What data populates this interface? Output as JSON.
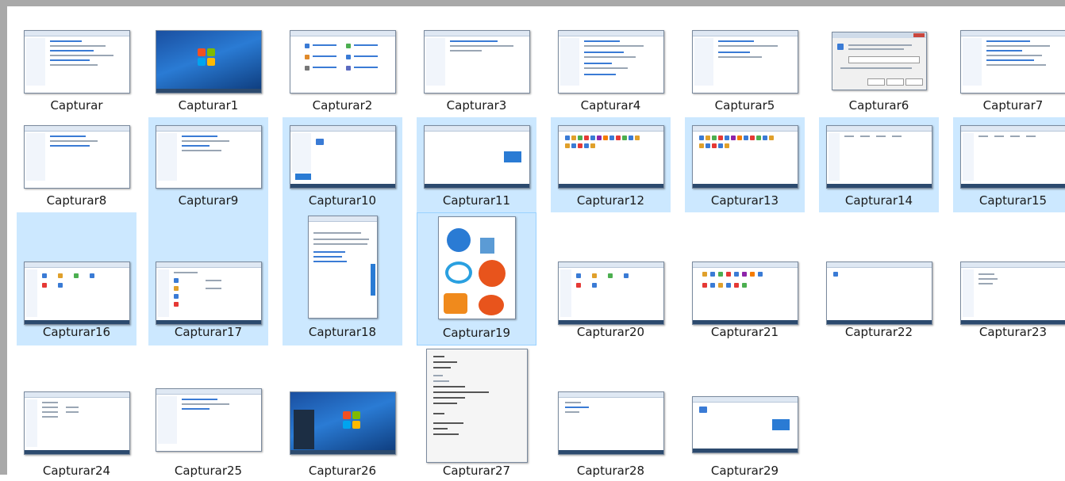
{
  "files": [
    {
      "name": "Capturar",
      "selected": false
    },
    {
      "name": "Capturar1",
      "selected": false
    },
    {
      "name": "Capturar2",
      "selected": false
    },
    {
      "name": "Capturar3",
      "selected": false
    },
    {
      "name": "Capturar4",
      "selected": false
    },
    {
      "name": "Capturar5",
      "selected": false
    },
    {
      "name": "Capturar6",
      "selected": false
    },
    {
      "name": "Capturar7",
      "selected": false
    },
    {
      "name": "Capturar8",
      "selected": false
    },
    {
      "name": "Capturar9",
      "selected": true
    },
    {
      "name": "Capturar10",
      "selected": true
    },
    {
      "name": "Capturar11",
      "selected": true
    },
    {
      "name": "Capturar12",
      "selected": true
    },
    {
      "name": "Capturar13",
      "selected": true
    },
    {
      "name": "Capturar14",
      "selected": true
    },
    {
      "name": "Capturar15",
      "selected": true
    },
    {
      "name": "Capturar16",
      "selected": true
    },
    {
      "name": "Capturar17",
      "selected": true
    },
    {
      "name": "Capturar18",
      "selected": true
    },
    {
      "name": "Capturar19",
      "selected": true,
      "focused": true
    },
    {
      "name": "Capturar20",
      "selected": false
    },
    {
      "name": "Capturar21",
      "selected": false
    },
    {
      "name": "Capturar22",
      "selected": false
    },
    {
      "name": "Capturar23",
      "selected": false
    },
    {
      "name": "Capturar24",
      "selected": false
    },
    {
      "name": "Capturar25",
      "selected": false
    },
    {
      "name": "Capturar26",
      "selected": false
    },
    {
      "name": "Capturar27",
      "selected": false
    },
    {
      "name": "Capturar28",
      "selected": false
    },
    {
      "name": "Capturar29",
      "selected": false
    }
  ],
  "colors": {
    "selection": "#cce8ff",
    "selection_border": "#99d1ff",
    "frame": "#a9a9a9"
  }
}
